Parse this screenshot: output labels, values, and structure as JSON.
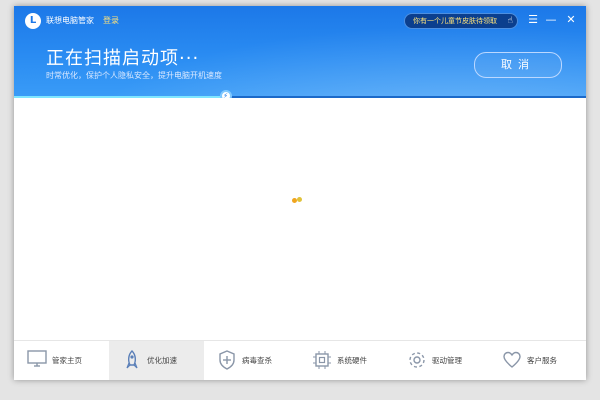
{
  "app": {
    "title": "联想电脑管家",
    "login": "登录",
    "logo_letter": "L"
  },
  "promo": {
    "text": "你有一个儿童节皮肤待领取",
    "icon": "hand-pointer-icon"
  },
  "window_controls": {
    "menu": "☰",
    "minimize": "—",
    "close": "✕"
  },
  "scan": {
    "title": "正在扫描启动项···",
    "subtitle": "时常优化，保护个人隐私安全，提升电脑开机速度",
    "cancel_label": "取消",
    "progress_percent": 37
  },
  "nav": [
    {
      "label": "管家主页",
      "icon": "monitor-icon",
      "active": false
    },
    {
      "label": "优化加速",
      "icon": "rocket-icon",
      "active": true
    },
    {
      "label": "病毒查杀",
      "icon": "shield-icon",
      "active": false
    },
    {
      "label": "系统硬件",
      "icon": "chip-icon",
      "active": false
    },
    {
      "label": "驱动管理",
      "icon": "gear-icon",
      "active": false
    },
    {
      "label": "客户服务",
      "icon": "heart-icon",
      "active": false
    }
  ],
  "colors": {
    "header": "#2a8cf2",
    "progress": "#7fe6ff",
    "accent": "#ffe37a"
  }
}
